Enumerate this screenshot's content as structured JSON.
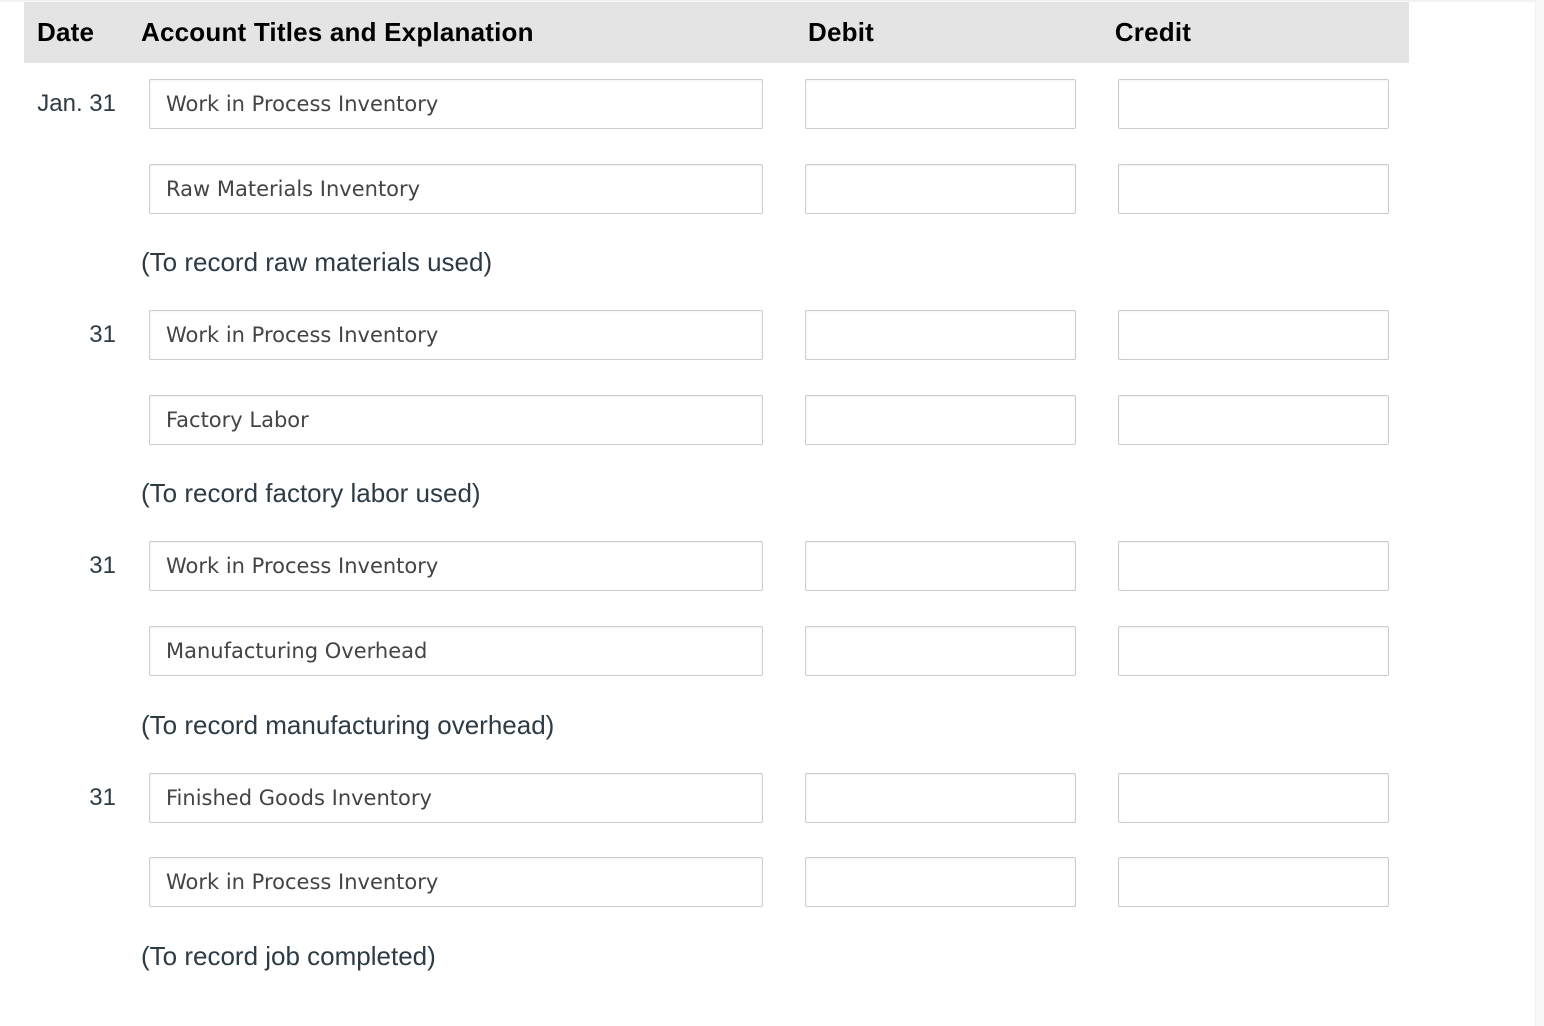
{
  "header": {
    "date": "Date",
    "account": "Account Titles and Explanation",
    "debit": "Debit",
    "credit": "Credit"
  },
  "entries": [
    {
      "date": "Jan. 31",
      "lines": [
        {
          "account": "Work in Process Inventory",
          "debit": "",
          "credit": ""
        },
        {
          "account": "Raw Materials Inventory",
          "debit": "",
          "credit": ""
        }
      ],
      "explanation": "(To record raw materials used)"
    },
    {
      "date": "31",
      "lines": [
        {
          "account": "Work in Process Inventory",
          "debit": "",
          "credit": ""
        },
        {
          "account": "Factory Labor",
          "debit": "",
          "credit": ""
        }
      ],
      "explanation": "(To record factory labor used)"
    },
    {
      "date": "31",
      "lines": [
        {
          "account": "Work in Process Inventory",
          "debit": "",
          "credit": ""
        },
        {
          "account": "Manufacturing Overhead",
          "debit": "",
          "credit": ""
        }
      ],
      "explanation": "(To record manufacturing overhead)"
    },
    {
      "date": "31",
      "lines": [
        {
          "account": "Finished Goods Inventory",
          "debit": "",
          "credit": ""
        },
        {
          "account": "Work in Process Inventory",
          "debit": "",
          "credit": ""
        }
      ],
      "explanation": "(To record job completed)"
    }
  ]
}
